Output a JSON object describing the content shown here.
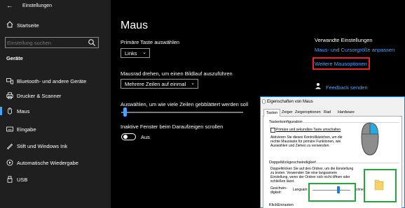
{
  "window": {
    "title": "Einstellungen"
  },
  "sidebar": {
    "home": "Startseite",
    "search_placeholder": "Einstellung suchen",
    "section": "Geräte",
    "items": [
      {
        "label": "Bluetooth- und andere Geräte",
        "icon": "bluetooth-icon"
      },
      {
        "label": "Drucker & Scanner",
        "icon": "printer-icon"
      },
      {
        "label": "Maus",
        "icon": "mouse-icon",
        "active": true
      },
      {
        "label": "Eingabe",
        "icon": "keyboard-icon"
      },
      {
        "label": "Stift und Windows Ink",
        "icon": "pen-icon"
      },
      {
        "label": "Automatische Wiedergabe",
        "icon": "autoplay-icon"
      },
      {
        "label": "USB",
        "icon": "usb-icon"
      }
    ]
  },
  "main": {
    "title": "Maus",
    "primary_button_label": "Primäre Taste auswählen",
    "primary_button_value": "Links",
    "scroll_label": "Mausrad drehen, um einen Bildlauf auszuführen",
    "scroll_value": "Mehrere Zeilen auf einmal",
    "lines_label": "Auswählen, um wie viele Zeilen gebblättert werden soll",
    "inactive_label": "Inaktive Fenster beim Daraufzeigen scrollen",
    "inactive_value": "Aus"
  },
  "related": {
    "heading": "Verwandte Einstellungen",
    "link1": "Maus- und Cursorgröße anpassen",
    "link2": "Weitere Mausoptionen",
    "feedback": "Feedback senden"
  },
  "dialog": {
    "title": "Eigenschaften von Maus",
    "tabs": [
      "Tasten",
      "Zeiger",
      "Zeigeroptionen",
      "Rad",
      "Hardware"
    ],
    "group1": "Tastenkonfiguration",
    "checkbox": "Primäre und sekundäre Taste umschalten",
    "desc1_l1": "Aktivieren Sie dieses Kontrollkästchen, um die",
    "desc1_l2": "rechte Maustaste für primäre Funktionen, wie",
    "desc1_l3": "Auswählen und Ziehen zu verwenden.",
    "group2": "Doppelklickgeschwindigkeit",
    "desc2_l1": "Doppelklicken Sie auf den Ordner, um die Einstellung",
    "desc2_l2": "zu testen. Verwenden Sie eine langsamere",
    "desc2_l3": "Einstellung, wenn der Ordner sich nicht öffnen oder",
    "desc2_l4": "schließen lässt.",
    "speed_label_1": "Geschwin-",
    "speed_label_2": "digkeit:",
    "slow": "Langsam",
    "fast": "chnell",
    "group3": "KlickEinrasten"
  },
  "colors": {
    "accent": "#4aa3ff",
    "highlight_red": "#e8222a",
    "highlight_green": "#22a63a"
  }
}
